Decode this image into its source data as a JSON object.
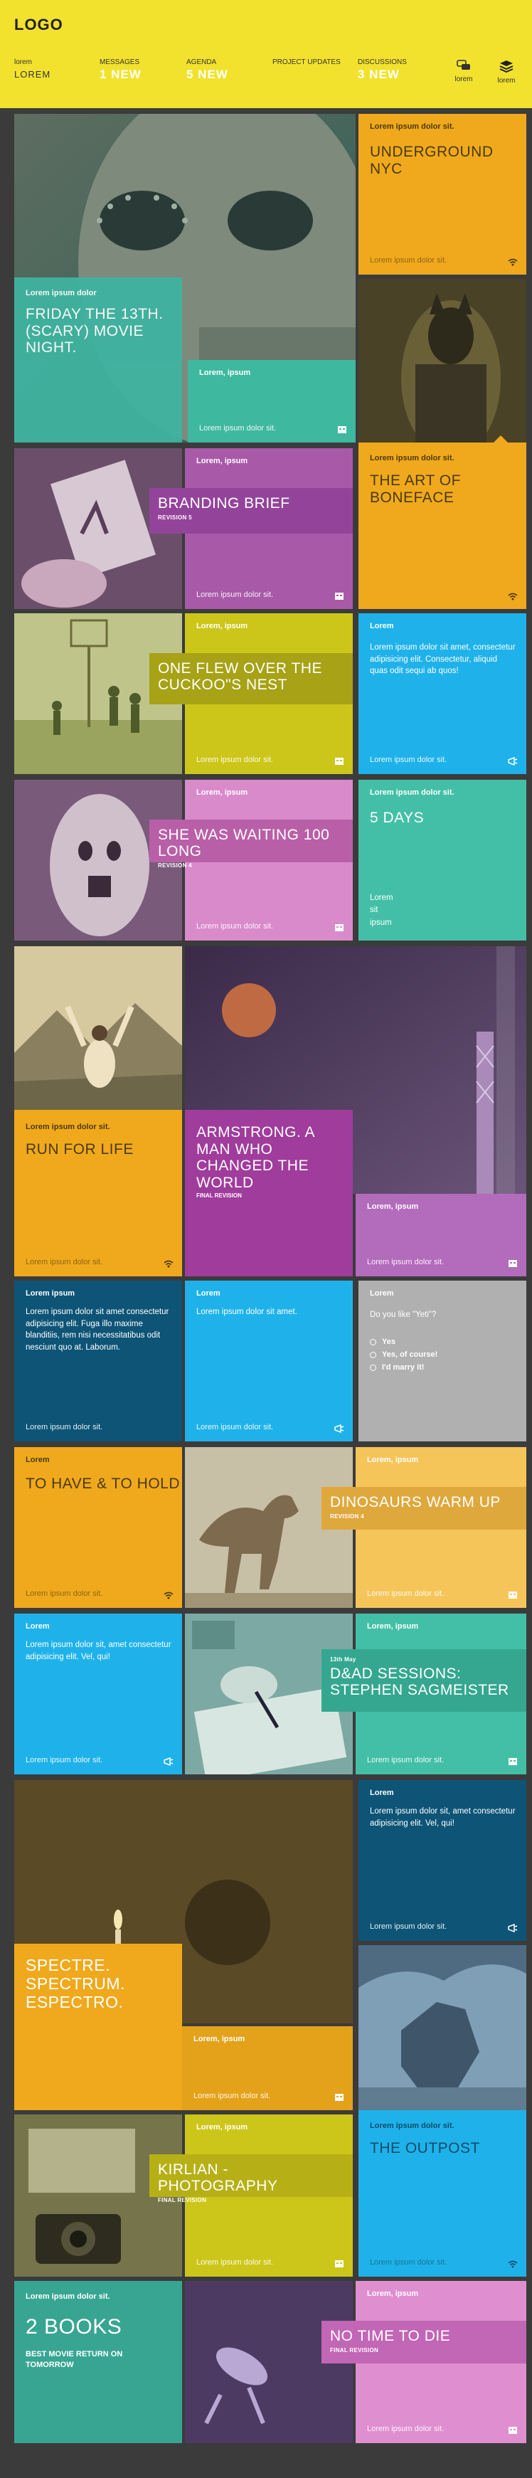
{
  "header": {
    "logo": "LOGO",
    "items": [
      {
        "small": "lorem",
        "big": "LOREM"
      },
      {
        "small": "MESSAGES",
        "big": "1 NEW"
      },
      {
        "small": "AGENDA",
        "big": "5 NEW"
      },
      {
        "small": "PROJECT UPDATES",
        "big": ""
      },
      {
        "small": "DISCUSSIONS",
        "big": "3 NEW"
      }
    ],
    "icons": [
      {
        "name": "lorem",
        "icon": "chat-icon"
      },
      {
        "name": "lorem",
        "icon": "layers-icon"
      }
    ]
  },
  "tiles": {
    "friday": {
      "label": "Lorem ipsum dolor",
      "title": "FRIDAY THE 13th.\n(SCARY) MOVIE NIGHT."
    },
    "underground": {
      "label": "Lorem ipsum dolor sit.",
      "title": "UNDERGROUND NYC",
      "foot": "Lorem ipsum dolor sit."
    },
    "teal1": {
      "label": "Lorem, ipsum",
      "foot": "Lorem ipsum dolor sit."
    },
    "boneface": {
      "label": "Lorem ipsum dolor sit.",
      "title": "THE ART OF BONEFACE"
    },
    "branding": {
      "label": "Lorem, ipsum",
      "title": "BRANDING BRIEF",
      "sub": "REVISION 5",
      "foot": "Lorem ipsum dolor sit."
    },
    "cuckoo": {
      "label": "Lorem, ipsum",
      "title": "ONE FLEW OVER THE CUCKOO\"S NEST",
      "foot": "Lorem ipsum dolor sit."
    },
    "blue1": {
      "label": "Lorem",
      "body": "Lorem ipsum dolor sit amet, consectetur adipisicing elit. Consectetur, aliquid quas odit sequi ab quos!",
      "foot": "Lorem ipsum dolor sit."
    },
    "waiting": {
      "label": "Lorem, ipsum",
      "title": "SHE WAS WAITING 100 LONG",
      "sub": "REVISION 4",
      "foot": "Lorem ipsum dolor sit."
    },
    "fivedays": {
      "label": "Lorem ipsum dolor sit.",
      "title": "5 DAYS",
      "lines": [
        "Lorem",
        "sit",
        "ipsum"
      ]
    },
    "runforlife": {
      "label": "Lorem ipsum dolor sit.",
      "title": "RUN FOR LIFE",
      "foot": "Lorem ipsum dolor sit."
    },
    "armstrong": {
      "title": "ARMSTRONG. A MAN WHO CHANGED THE WORLD",
      "sub": "FINAL REVISION"
    },
    "purple1": {
      "label": "Lorem, ipsum",
      "foot": "Lorem ipsum dolor sit."
    },
    "navy1": {
      "label": "Lorem ipsum",
      "body": "Lorem ipsum dolor sit amet consectetur adipisicing elit. Fuga illo maxime blanditiis, rem nisi necessitatibus odit nesciunt quo at. Laborum.",
      "foot": "Lorem ipsum dolor sit."
    },
    "blue2": {
      "label": "Lorem",
      "body": "Lorem ipsum dolor sit amet.",
      "foot": "Lorem ipsum dolor sit."
    },
    "poll": {
      "label": "Lorem",
      "question": "Do you like \"Yeti\"?",
      "options": [
        "Yes",
        "Yes, of course!",
        "I'd marry it!"
      ]
    },
    "tohave": {
      "label": "Lorem",
      "title": "TO HAVE & TO HOLD",
      "foot": "Lorem ipsum dolor sit."
    },
    "dinosaurs": {
      "label": "Lorem, ipsum",
      "title": "DINOSAURS WARM UP",
      "sub": "REVISION 4",
      "foot": "Lorem ipsum dolor sit."
    },
    "blue3": {
      "label": "Lorem",
      "body": "Lorem ipsum dolor sit, amet consectetur adipisicing elit. Vel, qui!",
      "foot": "Lorem ipsum dolor sit."
    },
    "dad": {
      "label": "Lorem, ipsum",
      "date": "13th May",
      "title": "D&AD SESSIONS: STEPHEN SAGMEISTER",
      "foot": "Lorem ipsum dolor sit."
    },
    "navy2": {
      "label": "Lorem",
      "body": "Lorem ipsum dolor sit, amet consectetur adipisicing elit. Vel, qui!",
      "foot": "Lorem ipsum dolor sit."
    },
    "spectre": {
      "title": "SPECTRE.\nSPECTRUM.\nESPECTRO."
    },
    "orange1": {
      "label": "Lorem, ipsum",
      "foot": "Lorem ipsum dolor sit."
    },
    "outpost": {
      "label": "Lorem ipsum dolor sit.",
      "title": "THE OUTPOST",
      "foot": "Lorem ipsum dolor sit."
    },
    "kirlian": {
      "label": "Lorem, ipsum",
      "title": "KIRLIAN - PHOTOGRAPHY",
      "sub": "FINAL REVISION",
      "foot": "Lorem ipsum dolor sit."
    },
    "twobooks": {
      "label": "Lorem ipsum dolor sit.",
      "title": "2 BOOKS",
      "sub": "BEST MOVIE RETURN ON TOMORROW"
    },
    "notime": {
      "label": "Lorem, ipsum",
      "title": "NO TIME TO DIE",
      "sub": "FINAL REVISION",
      "foot": "Lorem ipsum dolor sit."
    }
  },
  "colors": {
    "yellow": "#f2e22e",
    "orange": "#f0a91c",
    "teal": "#43b8a0",
    "purple": "#a85aa8",
    "pink": "#d98acb",
    "lime": "#cdc61a",
    "blue": "#1fb2ea",
    "navy": "#0e5476",
    "grey": "#b0b0b0"
  }
}
